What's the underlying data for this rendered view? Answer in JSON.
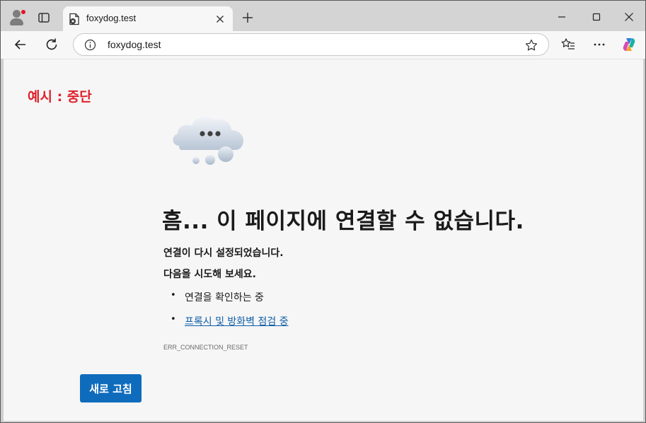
{
  "browser": {
    "tab": {
      "title": "foxydog.test"
    },
    "address": {
      "url": "foxydog.test"
    }
  },
  "page": {
    "example_label": "예시 : 중단",
    "heading": "흠... 이 페이지에 연결할 수 없습니다.",
    "subtitle": "연결이 다시 설정되었습니다.",
    "try_text": "다음을 시도해 보세요.",
    "suggestions": [
      {
        "text": "연결을 확인하는 중",
        "link": false
      },
      {
        "text": "프록시 및 방화벽 점검 중",
        "link": true
      }
    ],
    "error_code": "ERR_CONNECTION_RESET",
    "reload_button": "새로 고침"
  },
  "colors": {
    "accent": "#0f6cbd",
    "link": "#0f5ea8",
    "label_red": "#e0202a",
    "notification_dot": "#e81123"
  },
  "icons": [
    "profile-icon",
    "tab-actions-icon",
    "page-error-icon",
    "close-icon",
    "plus-icon",
    "minimize-icon",
    "maximize-icon",
    "window-close-icon",
    "back-arrow-icon",
    "refresh-icon",
    "info-icon",
    "star-icon",
    "favorites-icon",
    "more-icon",
    "copilot-icon",
    "cloud-icon"
  ]
}
